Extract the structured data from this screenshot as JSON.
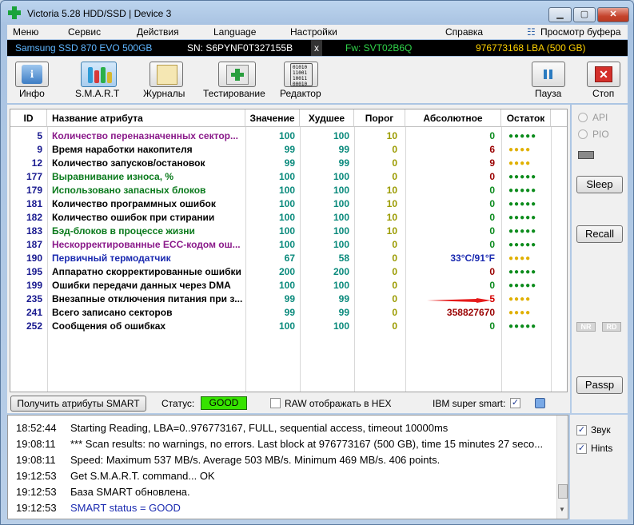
{
  "window": {
    "title": "Victoria 5.28 HDD/SSD | Device 3"
  },
  "menu": [
    {
      "label": "Меню"
    },
    {
      "label": "Сервис"
    },
    {
      "label": "Действия"
    },
    {
      "label": "Language"
    },
    {
      "label": "Настройки"
    },
    {
      "label": "Справка"
    },
    {
      "label": "Просмотр буфера"
    }
  ],
  "device_bar": {
    "model": "Samsung SSD 870 EVO 500GB",
    "serial": "SN: S6PYNF0T327155B",
    "close": "x",
    "firmware": "Fw: SVT02B6Q",
    "capacity": "976773168 LBA (500 GB)"
  },
  "toolbar": [
    {
      "label": "Инфо",
      "icon": "info-icon"
    },
    {
      "label": "S.M.A.R.T",
      "icon": "smart-icon"
    },
    {
      "label": "Журналы",
      "icon": "journal-icon"
    },
    {
      "label": "Тестирование",
      "icon": "test-icon"
    },
    {
      "label": "Редактор",
      "icon": "editor-icon"
    },
    {
      "label": "Пауза",
      "icon": "pause-icon"
    },
    {
      "label": "Стоп",
      "icon": "stop-icon"
    }
  ],
  "editor_icon_text": "01010\n11001\n10011\n00010",
  "smart_table": {
    "headers": [
      "ID",
      "Название атрибута",
      "Значение",
      "Худшее",
      "Порог",
      "Абсолютное",
      "Остаток"
    ],
    "rows": [
      {
        "id": "5",
        "name": "Количество переназначенных сектор...",
        "value": "100",
        "worst": "100",
        "threshold": "10",
        "raw": "0",
        "remaining": "●●●●●",
        "name_color": "#8a1a8a",
        "raw_color": "#0a8a1c",
        "rem_class": "rem-green"
      },
      {
        "id": "9",
        "name": "Время наработки накопителя",
        "value": "99",
        "worst": "99",
        "threshold": "0",
        "raw": "6",
        "remaining": "●●●●",
        "name_color": "#000000",
        "raw_color": "#9a0000",
        "rem_class": "rem-yellow"
      },
      {
        "id": "12",
        "name": "Количество запусков/остановок",
        "value": "99",
        "worst": "99",
        "threshold": "0",
        "raw": "9",
        "remaining": "●●●●",
        "name_color": "#000000",
        "raw_color": "#9a0000",
        "rem_class": "rem-yellow"
      },
      {
        "id": "177",
        "name": "Выравнивание износа, %",
        "value": "100",
        "worst": "100",
        "threshold": "0",
        "raw": "0",
        "remaining": "●●●●●",
        "name_color": "#0a7a1c",
        "raw_color": "#9a0000",
        "rem_class": "rem-green"
      },
      {
        "id": "179",
        "name": "Использовано запасных блоков",
        "value": "100",
        "worst": "100",
        "threshold": "10",
        "raw": "0",
        "remaining": "●●●●●",
        "name_color": "#0a7a1c",
        "raw_color": "#0a8a1c",
        "rem_class": "rem-green"
      },
      {
        "id": "181",
        "name": "Количество программных ошибок",
        "value": "100",
        "worst": "100",
        "threshold": "10",
        "raw": "0",
        "remaining": "●●●●●",
        "name_color": "#000000",
        "raw_color": "#0a8a1c",
        "rem_class": "rem-green"
      },
      {
        "id": "182",
        "name": "Количество ошибок при стирании",
        "value": "100",
        "worst": "100",
        "threshold": "10",
        "raw": "0",
        "remaining": "●●●●●",
        "name_color": "#000000",
        "raw_color": "#0a8a1c",
        "rem_class": "rem-green"
      },
      {
        "id": "183",
        "name": "Бэд-блоков в процессе жизни",
        "value": "100",
        "worst": "100",
        "threshold": "10",
        "raw": "0",
        "remaining": "●●●●●",
        "name_color": "#0a7a1c",
        "raw_color": "#0a8a1c",
        "rem_class": "rem-green"
      },
      {
        "id": "187",
        "name": "Нескорректированные ECC-кодом ош...",
        "value": "100",
        "worst": "100",
        "threshold": "0",
        "raw": "0",
        "remaining": "●●●●●",
        "name_color": "#8a1a8a",
        "raw_color": "#0a8a1c",
        "rem_class": "rem-green"
      },
      {
        "id": "190",
        "name": "Первичный термодатчик",
        "value": "67",
        "worst": "58",
        "threshold": "0",
        "raw": "33°C/91°F",
        "remaining": "●●●●",
        "name_color": "#1a2ab0",
        "raw_color": "#1a2ab0",
        "rem_class": "rem-yellow"
      },
      {
        "id": "195",
        "name": "Аппаратно скорректированные ошибки",
        "value": "200",
        "worst": "200",
        "threshold": "0",
        "raw": "0",
        "remaining": "●●●●●",
        "name_color": "#000000",
        "raw_color": "#9a0000",
        "rem_class": "rem-green"
      },
      {
        "id": "199",
        "name": "Ошибки передачи данных через DMA",
        "value": "100",
        "worst": "100",
        "threshold": "0",
        "raw": "0",
        "remaining": "●●●●●",
        "name_color": "#000000",
        "raw_color": "#0a8a1c",
        "rem_class": "rem-green"
      },
      {
        "id": "235",
        "name": "Внезапные отключения питания при з...",
        "value": "99",
        "worst": "99",
        "threshold": "0",
        "raw": "5",
        "remaining": "●●●●",
        "name_color": "#000000",
        "raw_color": "#d40000",
        "rem_class": "rem-yellow"
      },
      {
        "id": "241",
        "name": "Всего записано секторов",
        "value": "99",
        "worst": "99",
        "threshold": "0",
        "raw": "358827670",
        "remaining": "●●●●",
        "name_color": "#000000",
        "raw_color": "#9a0000",
        "rem_class": "rem-yellow"
      },
      {
        "id": "252",
        "name": "Сообщения об ошибках",
        "value": "100",
        "worst": "100",
        "threshold": "0",
        "raw": "0",
        "remaining": "●●●●●",
        "name_color": "#000000",
        "raw_color": "#0a8a1c",
        "rem_class": "rem-green"
      }
    ]
  },
  "bottom_bar": {
    "get_smart_label": "Получить атрибуты SMART",
    "status_label": "Статус:",
    "status_value": "GOOD",
    "raw_hex_label": "RAW отображать в HEX",
    "raw_hex_checked": false,
    "ibm_label": "IBM super smart:",
    "ibm_checked": true
  },
  "right_panel": {
    "api_label": "API",
    "pio_label": "PIO",
    "sleep_label": "Sleep",
    "recall_label": "Recall",
    "nr_label": "NR",
    "rd_label": "RD",
    "passp_label": "Passp"
  },
  "log": [
    {
      "time": "18:52:44",
      "msg": "Starting Reading, LBA=0..976773167, FULL, sequential access, timeout 10000ms",
      "color": "#000000"
    },
    {
      "time": "19:08:11",
      "msg": "*** Scan results: no warnings, no errors. Last block at 976773167 (500 GB), time 15 minutes 27 seco...",
      "color": "#000000"
    },
    {
      "time": "19:08:11",
      "msg": "Speed: Maximum 537 MB/s. Average 503 MB/s. Minimum 469 MB/s. 406 points.",
      "color": "#000000"
    },
    {
      "time": "19:12:53",
      "msg": "Get S.M.A.R.T. command... OK",
      "color": "#000000"
    },
    {
      "time": "19:12:53",
      "msg": "База SMART обновлена.",
      "color": "#000000"
    },
    {
      "time": "19:12:53",
      "msg": "SMART status = GOOD",
      "color": "#1a2ab0"
    }
  ],
  "log_side": {
    "sound_label": "Звук",
    "sound_checked": true,
    "hints_label": "Hints",
    "hints_checked": true
  }
}
